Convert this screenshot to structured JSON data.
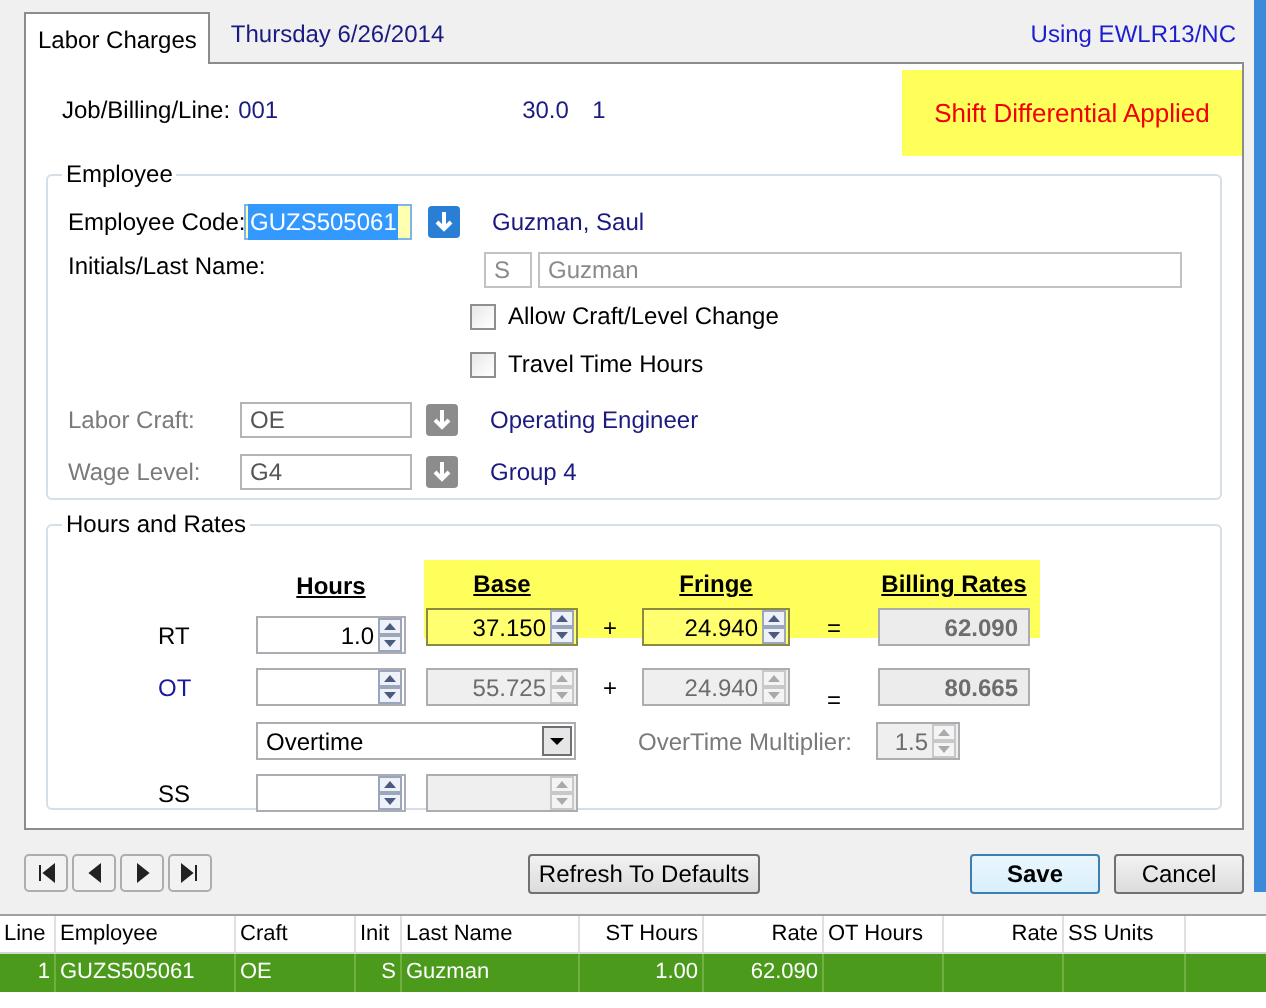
{
  "tab": {
    "label": "Labor Charges",
    "selected": true
  },
  "date": "Thursday  6/26/2014",
  "using": "Using EWLR13/NC",
  "job": {
    "label": "Job/Billing/Line:",
    "values": [
      "001",
      "30.0",
      "1"
    ],
    "notice": "Shift Differential Applied"
  },
  "employee": {
    "title": "Employee",
    "code_label": "Employee Code:",
    "code": "GUZS505061",
    "code_name": "Guzman, Saul",
    "initials_label": "Initials/Last Name:",
    "initials": "S",
    "last_name": "Guzman",
    "checkboxes": [
      {
        "label": "Allow Craft/Level Change",
        "checked": false
      },
      {
        "label": "Travel Time Hours",
        "checked": false
      }
    ],
    "lookups": [
      {
        "label": "Labor Craft:",
        "value": "OE",
        "name": "Operating Engineer"
      },
      {
        "label": "Wage Level:",
        "value": "G4",
        "name": "Group 4"
      }
    ]
  },
  "hours_rates": {
    "title": "Hours and Rates",
    "columns": [
      "Hours",
      "Base",
      "Fringe",
      "Billing Rates"
    ],
    "rt": {
      "label": "RT",
      "hours": "1.0",
      "base": "37.150",
      "plus": "+",
      "fringe": "24.940",
      "equals": "=",
      "billing": "62.090"
    },
    "ot": {
      "label": "OT",
      "base": "55.725",
      "plus": "+",
      "fringe": "24.940",
      "equals": "=",
      "billing": "80.665"
    },
    "ot_type": "Overtime",
    "multiplier_label": "OverTime Multiplier:",
    "multiplier": "1.5",
    "ss": {
      "label": "SS"
    }
  },
  "buttons": {
    "refresh": "Refresh To Defaults",
    "save": "Save",
    "cancel": "Cancel"
  },
  "table": {
    "columns": [
      "Line",
      "Employee",
      "Craft",
      "Init",
      "Last Name",
      "ST Hours",
      "Rate",
      "OT Hours",
      "Rate",
      "SS Units"
    ],
    "rows": [
      {
        "selected": true,
        "cells": [
          "1",
          "GUZS505061",
          "OE",
          "S",
          "Guzman",
          "1.00",
          "62.090",
          "",
          "",
          ""
        ]
      }
    ]
  }
}
